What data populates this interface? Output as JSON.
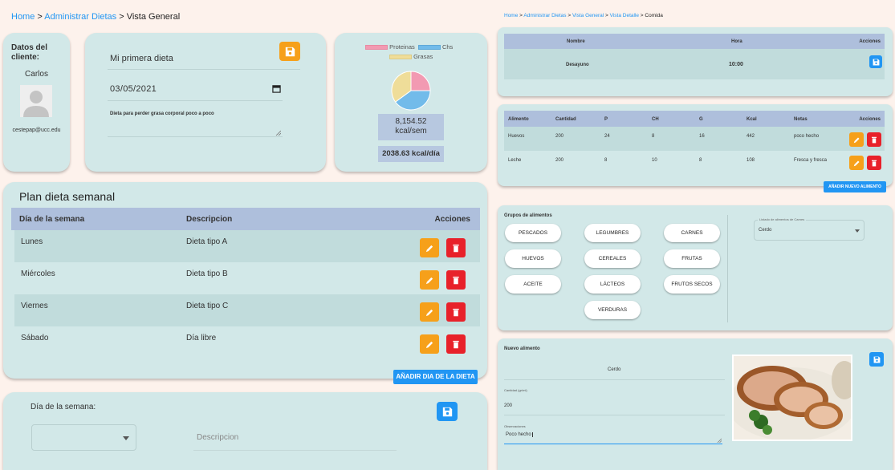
{
  "left": {
    "breadcrumb": {
      "home": "Home",
      "sep1": " > ",
      "admin": "Administrar Dietas",
      "sep2": " > ",
      "current": "Vista General"
    },
    "client": {
      "title": "Datos del cliente:",
      "name": "Carlos",
      "email": "cestepap@ucc.edu"
    },
    "diet": {
      "name": "Mi primera dieta",
      "date": "03/05/2021",
      "description": "Dieta para perder grasa corporal poco a poco"
    },
    "macros": {
      "legend": [
        "Proteinas",
        "Chs",
        "Grasas"
      ],
      "weekly_kcal": "8,154.52 kcal/sem",
      "daily_kcal": "2038.63 kcal/día",
      "chart_data": {
        "type": "pie",
        "categories": [
          "Proteinas",
          "Chs",
          "Grasas"
        ],
        "values": [
          25,
          40,
          35
        ],
        "colors": [
          "#f29ab2",
          "#72bbea",
          "#efdd99"
        ]
      }
    },
    "plan": {
      "title": "Plan dieta semanal",
      "headers": [
        "Día de la semana",
        "Descripcion",
        "Acciones"
      ],
      "rows": [
        {
          "day": "Lunes",
          "desc": "Dieta tipo A"
        },
        {
          "day": "Miércoles",
          "desc": "Dieta tipo B"
        },
        {
          "day": "Viernes",
          "desc": "Dieta tipo C"
        },
        {
          "day": "Sábado",
          "desc": "Día libre"
        }
      ],
      "add_button": "AÑADIR DIA DE LA DIETA"
    },
    "new_day": {
      "day_label": "Día de la semana:",
      "desc_placeholder": "Descripcion"
    }
  },
  "right": {
    "breadcrumb": {
      "home": "Home",
      "s1": " > ",
      "admin": "Administrar Dietas",
      "s2": " > ",
      "general": "Vista General",
      "s3": " > ",
      "detail": "Vista Detalle",
      "s4": " > ",
      "current": "Comida"
    },
    "meal": {
      "headers": [
        "Nombre",
        "Hora",
        "Acciones"
      ],
      "name": "Desayuno",
      "time": "10:00"
    },
    "foods": {
      "headers": [
        "Alimento",
        "Cantidad",
        "P",
        "CH",
        "G",
        "Kcal",
        "Notas",
        "Acciones"
      ],
      "rows": [
        [
          "Huevos",
          "200",
          "24",
          "8",
          "16",
          "442",
          "poco hecho"
        ],
        [
          "Leche",
          "200",
          "8",
          "10",
          "8",
          "108",
          "Fresca y fresca"
        ]
      ],
      "add_button": "AÑADIR NUEVO ALIMENTO"
    },
    "groups": {
      "title": "Grupos de alimentos",
      "items": [
        "PESCADOS",
        "LEGUMBRES",
        "CARNES",
        "HUEVOS",
        "CEREALES",
        "FRUTAS",
        "ACEITE",
        "LÁCTEOS",
        "FRUTOS SECOS",
        "VERDURAS"
      ],
      "list_label": "Listado de alimentos de Carnes",
      "list_value": "Cerdo"
    },
    "new_food": {
      "title": "Nuevo alimento",
      "food": "Cerdo",
      "qty_label": "Cantidad (gr/ml)",
      "qty_value": "200",
      "obs_label": "Observaciones",
      "obs_value": "Poco hecho"
    }
  },
  "colors": {
    "card": "#d2e8e8",
    "header": "#aebfdc",
    "accent": "#2196f3",
    "edit": "#f6a01a",
    "delete": "#e8212a"
  }
}
